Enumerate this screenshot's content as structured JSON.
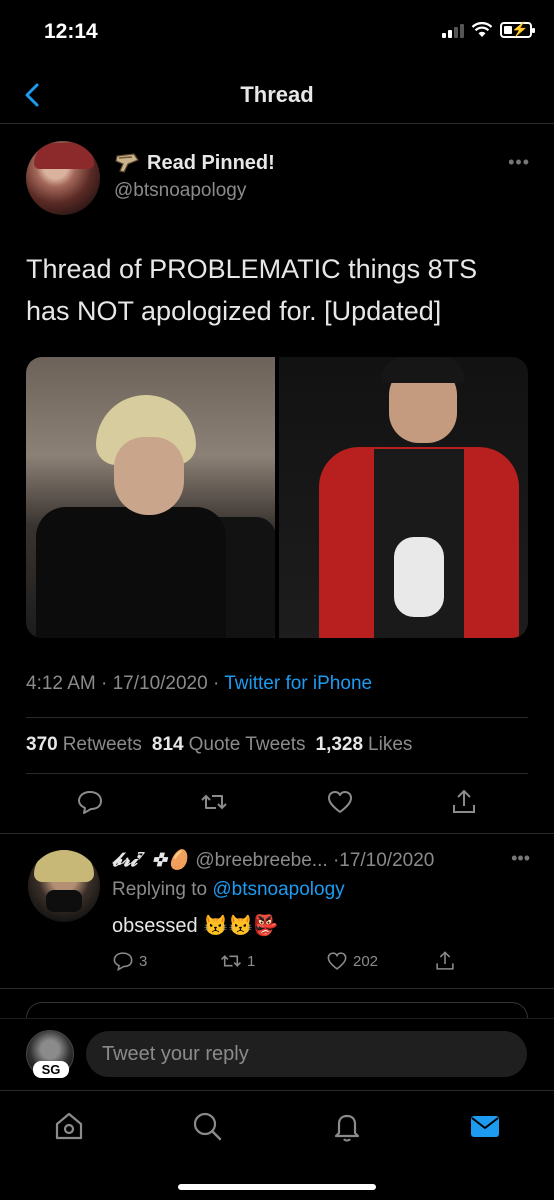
{
  "status_bar": {
    "time": "12:14"
  },
  "nav": {
    "title": "Thread"
  },
  "tweet": {
    "pinned_label": "Read Pinned!",
    "handle": "@btsnoapology",
    "text": "Thread of PROBLEMATIC things 8TS has NOT apologized for. [Updated]",
    "time": "4:12 AM · 17/10/2020 · ",
    "source": "Twitter for iPhone",
    "stats": {
      "retweets_count": "370",
      "retweets_label": "Retweets",
      "quotes_count": "814",
      "quotes_label": "Quote Tweets",
      "likes_count": "1,328",
      "likes_label": "Likes"
    }
  },
  "reply": {
    "name": "𝓫𝓻𝓲⁷ ✜🥚",
    "handle": "@breebreebe...",
    "date": "·17/10/2020",
    "replying_prefix": "Replying to ",
    "replying_to": "@btsnoapology",
    "text": "obsessed 😾😾👺",
    "replies": "3",
    "retweets": "1",
    "likes": "202"
  },
  "composer": {
    "placeholder": "Tweet your reply",
    "avatar_badge": "SG"
  },
  "colors": {
    "accent": "#1d9bf0",
    "background": "#000000",
    "muted": "#8b8b8b"
  },
  "icons": [
    "back-chevron-icon",
    "pin-emoji-icon",
    "reply-icon",
    "retweet-icon",
    "like-icon",
    "share-icon",
    "home-icon",
    "search-icon",
    "notifications-icon",
    "messages-icon"
  ]
}
